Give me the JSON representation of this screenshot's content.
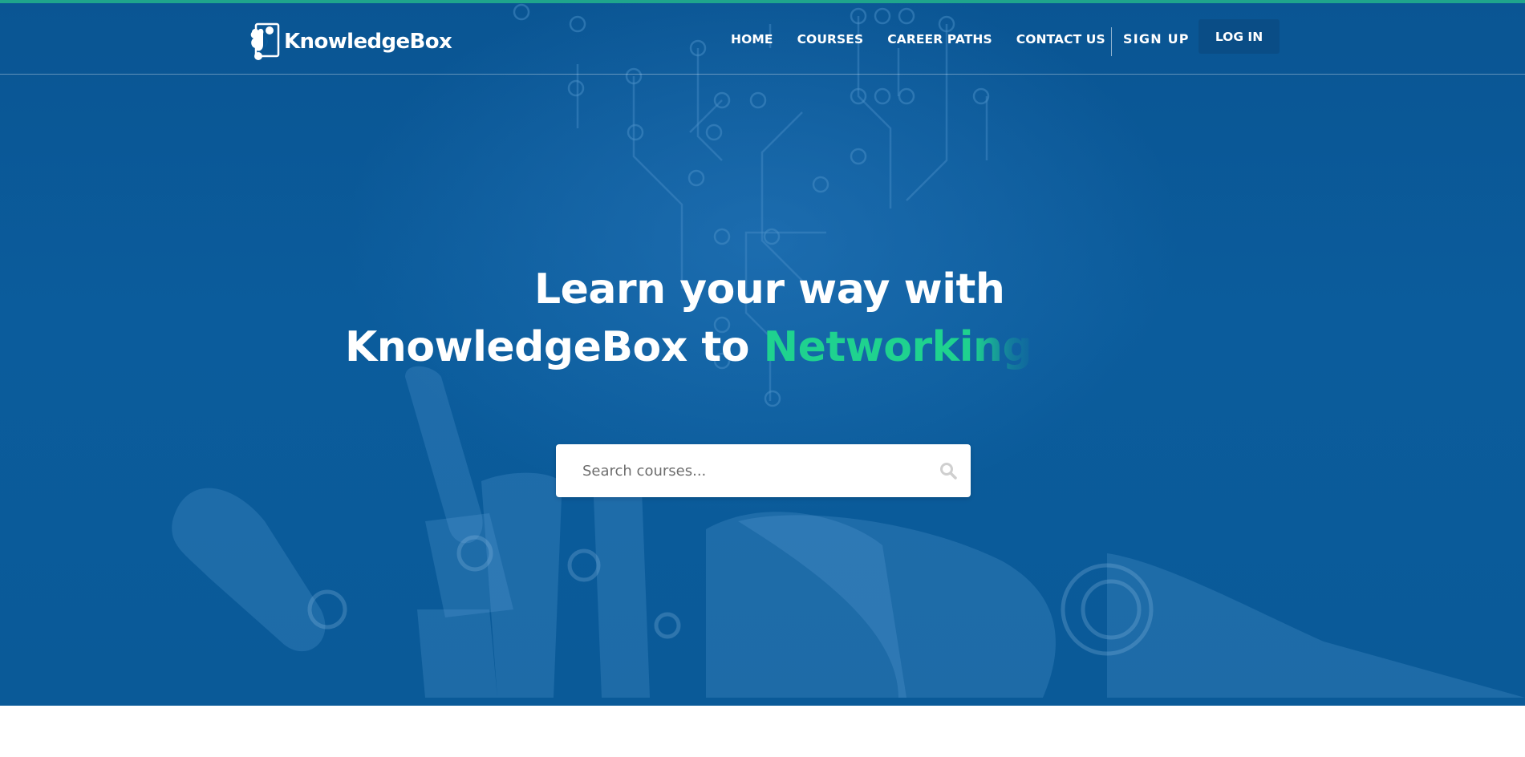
{
  "brand": {
    "name": "KnowledgeBox",
    "logo_icon": "knowledgebox-logo-icon"
  },
  "nav": {
    "items": [
      {
        "label": "HOME"
      },
      {
        "label": "COURSES"
      },
      {
        "label": "CAREER PATHS"
      },
      {
        "label": "CONTACT US"
      }
    ],
    "signup_label": "SIGN UP",
    "login_label": "LOG IN"
  },
  "hero": {
    "headline_line1": "Learn your way with",
    "headline_line2_prefix": "KnowledgeBox to",
    "typed_word": "Networking",
    "background_image": "robot-hand-circuit"
  },
  "search": {
    "placeholder": "Search courses...",
    "value": "",
    "icon": "search-icon"
  },
  "colors": {
    "hero_bg": "#0b5c9c",
    "accent_line": "#1fa58c",
    "typed_accent": "#1fd28f",
    "login_bg": "#0a4d86"
  }
}
